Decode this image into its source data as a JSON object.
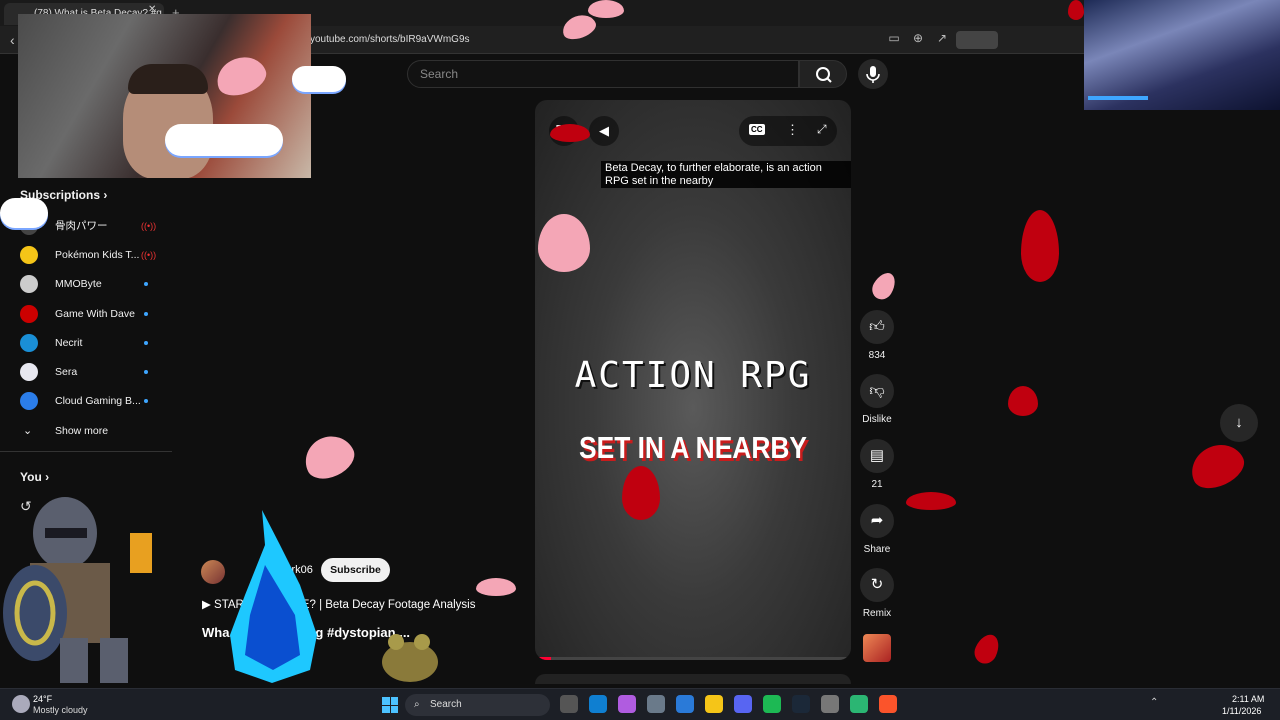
{
  "browser": {
    "tab_title": "(78) What is Beta Decay? #g",
    "url": "youtube.com/shorts/bIR9aVWmG9s"
  },
  "header": {
    "search_placeholder": "Search"
  },
  "sidebar": {
    "subscriptions_heading": "Subscriptions",
    "subscriptions": [
      {
        "name": "骨肉パワー",
        "status": "live",
        "color": "#444"
      },
      {
        "name": "Pokémon Kids T...",
        "status": "live",
        "color": "#f5c518"
      },
      {
        "name": "MMOByte",
        "status": "new",
        "color": "#ccc"
      },
      {
        "name": "Game With Dave",
        "status": "new",
        "color": "#c00"
      },
      {
        "name": "Necrit",
        "status": "new",
        "color": "#1a8fd6"
      },
      {
        "name": "Sera",
        "status": "new",
        "color": "#e8e8f0"
      },
      {
        "name": "Cloud Gaming B...",
        "status": "new",
        "color": "#2b7de9"
      }
    ],
    "show_more": "Show more",
    "you_heading": "You"
  },
  "video": {
    "caption": "Beta Decay, to further elaborate, is an action RPG set in the nearby",
    "overlay_line1": "ACTION RPG",
    "overlay_line2": "SET IN A NEARBY",
    "progress": 0.05
  },
  "actions": {
    "like_count": "834",
    "dislike_label": "Dislike",
    "comment_count": "21",
    "share_label": "Share",
    "remix_label": "Remix"
  },
  "channel": {
    "name": "Berk06",
    "subscribe_label": "Subscribe",
    "related_title": "STAR... IN SPACE? | Beta Decay Footage Analysis",
    "short_title": "Wha... ay? #gaming #dystopian ..."
  },
  "taskbar": {
    "temperature": "24°F",
    "condition": "Mostly cloudy",
    "search_label": "Search",
    "time": "2:11 AM",
    "date": "1/11/2026"
  },
  "colors": {
    "accent": "#3ea6ff",
    "live": "#e33",
    "progress": "#ff0033"
  }
}
